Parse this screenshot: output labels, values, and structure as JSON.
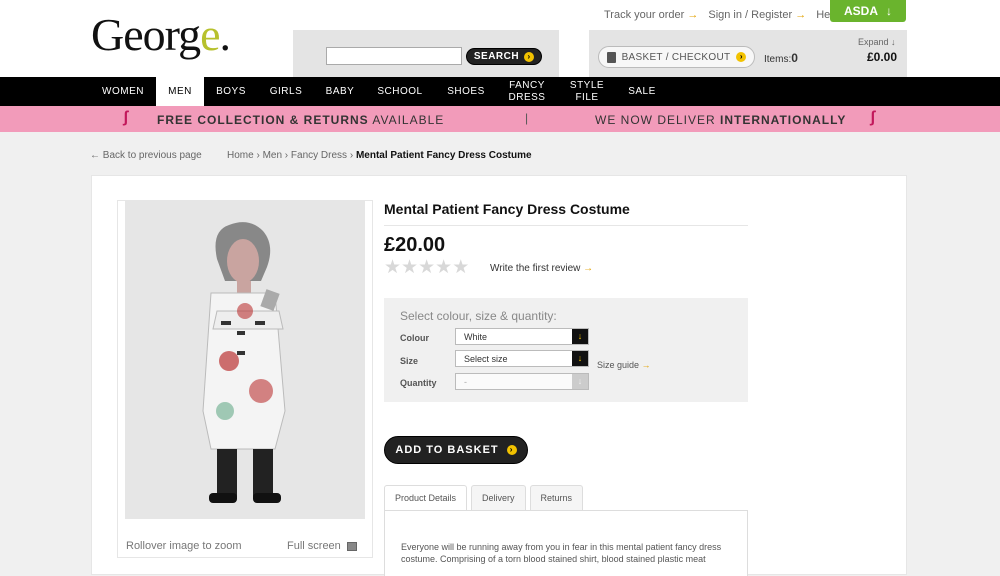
{
  "brand": {
    "logo_main": "Georg",
    "logo_accent": "e",
    "logo_dot": "."
  },
  "search": {
    "placeholder": "",
    "button_label": "SEARCH"
  },
  "toplinks": {
    "track_order": "Track your order",
    "sign_in": "Sign in / Register",
    "help": "Help"
  },
  "asda": {
    "label": "ASDA"
  },
  "basket": {
    "button_label": "BASKET / CHECKOUT",
    "items_label": "Items:",
    "items_count": "0",
    "expand_label": "Expand",
    "total": "£0.00"
  },
  "nav": [
    {
      "label": "WOMEN",
      "active": false
    },
    {
      "label": "MEN",
      "active": true
    },
    {
      "label": "BOYS",
      "active": false
    },
    {
      "label": "GIRLS",
      "active": false
    },
    {
      "label": "BABY",
      "active": false
    },
    {
      "label": "SCHOOL",
      "active": false
    },
    {
      "label": "SHOES",
      "active": false
    },
    {
      "label": "FANCY\nDRESS",
      "active": false
    },
    {
      "label": "STYLE\nFILE",
      "active": false
    },
    {
      "label": "SALE",
      "active": false
    }
  ],
  "promo": {
    "left_bold": "FREE COLLECTION & RETURNS",
    "left_rest": " AVAILABLE",
    "right_prefix": "WE NOW DELIVER ",
    "right_bold": "INTERNATIONALLY"
  },
  "back_link": "Back to previous page",
  "breadcrumb": {
    "items": [
      "Home",
      "Men",
      "Fancy Dress"
    ],
    "current": "Mental Patient Fancy Dress Costume"
  },
  "product": {
    "title": "Mental Patient Fancy Dress Costume",
    "price": "£20.00",
    "rating_stars": 0,
    "review_link": "Write the first review",
    "image_caption": "Rollover image to zoom",
    "fullscreen_label": "Full screen"
  },
  "options": {
    "heading": "Select colour, size & quantity:",
    "colour_label": "Colour",
    "colour_value": "White",
    "size_label": "Size",
    "size_value": "Select size",
    "size_guide": "Size guide",
    "quantity_label": "Quantity",
    "quantity_value": "-"
  },
  "add_to_basket": "ADD TO BASKET",
  "tabs": [
    "Product Details",
    "Delivery",
    "Returns"
  ],
  "description": "Everyone will be running away from you in fear in this mental patient fancy dress costume. Comprising of a torn blood stained shirt, blood stained plastic meat",
  "colors": {
    "nav_bg": "#000000",
    "promo_bg": "#f29bba",
    "asda_green": "#6ab42d",
    "accent_yellow": "#f2c200"
  }
}
